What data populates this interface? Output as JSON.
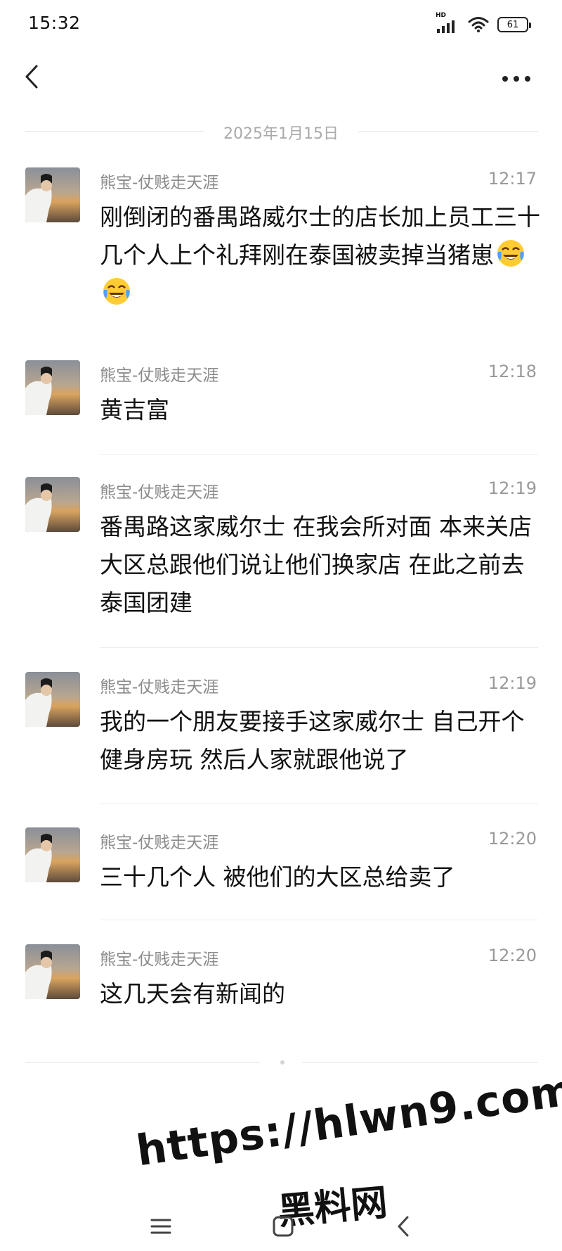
{
  "status_bar": {
    "time": "15:32",
    "network_label": "HD",
    "battery": "61"
  },
  "header": {
    "back_icon": "chevron-left-icon",
    "more_icon": "more-horizontal-icon"
  },
  "date_divider": "2025年1月15日",
  "messages": [
    {
      "sender": "熊宝-仗贱走天涯",
      "time": "12:17",
      "text": "刚倒闭的番禺路威尔士的店长加上员工三十几个人上个礼拜刚在泰国被卖掉当猪崽",
      "emoji": [
        "face-with-tears-of-joy-icon",
        "face-with-tears-of-joy-icon"
      ]
    },
    {
      "sender": "熊宝-仗贱走天涯",
      "time": "12:18",
      "text": "黄吉富"
    },
    {
      "sender": "熊宝-仗贱走天涯",
      "time": "12:19",
      "text": "番禺路这家威尔士 在我会所对面 本来关店 大区总跟他们说让他们换家店 在此之前去泰国团建"
    },
    {
      "sender": "熊宝-仗贱走天涯",
      "time": "12:19",
      "text": "我的一个朋友要接手这家威尔士 自己开个健身房玩 然后人家就跟他说了"
    },
    {
      "sender": "熊宝-仗贱走天涯",
      "time": "12:20",
      "text": "三十几个人 被他们的大区总给卖了"
    },
    {
      "sender": "熊宝-仗贱走天涯",
      "time": "12:20",
      "text": "这几天会有新闻的"
    }
  ],
  "watermark": {
    "line1": "https://hlwn9.com",
    "line2": "黑料网"
  },
  "nav_bar": {
    "menu_icon": "menu-icon",
    "home_icon": "home-square-icon",
    "back_icon": "back-chevron-icon"
  }
}
